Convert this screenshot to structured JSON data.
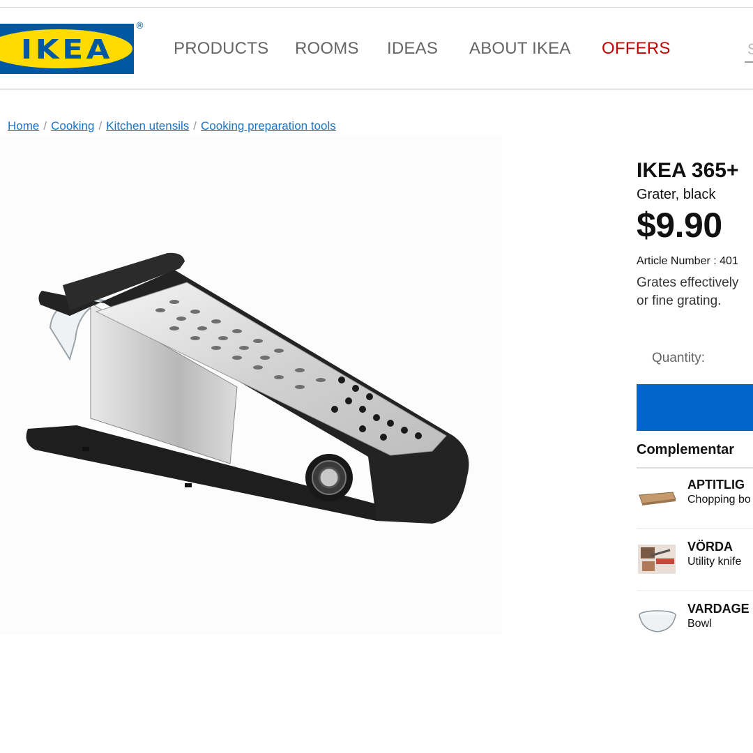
{
  "header": {
    "logo_text": "IKEA",
    "logo_reg": "®",
    "nav": [
      "PRODUCTS",
      "ROOMS",
      "IDEAS",
      "ABOUT IKEA",
      "OFFERS"
    ],
    "search_placeholder": "S"
  },
  "breadcrumb": [
    "Home",
    "Cooking",
    "Kitchen utensils",
    "Cooking preparation tools"
  ],
  "product": {
    "name": "IKEA 365+",
    "subtitle": "Grater, black",
    "price": "$9.90",
    "article_number": "Article Number : 401",
    "description": [
      "Grates effectively",
      "or fine grating."
    ],
    "quantity_label": "Quantity:"
  },
  "complementary": {
    "title": "Complementar",
    "items": [
      {
        "name": "APTITLIG",
        "type": "Chopping bo",
        "icon": "cutting-board-thumb"
      },
      {
        "name": "VÖRDA",
        "type": "Utility knife",
        "icon": "knife-thumb"
      },
      {
        "name": "VARDAGE",
        "type": "Bowl",
        "icon": "glass-bowl-thumb"
      }
    ]
  },
  "colors": {
    "brand_blue": "#0058a3",
    "brand_yellow": "#ffdb00",
    "offer_red": "#c40000",
    "link_blue": "#1a73c8",
    "button_blue": "#0066cc"
  }
}
